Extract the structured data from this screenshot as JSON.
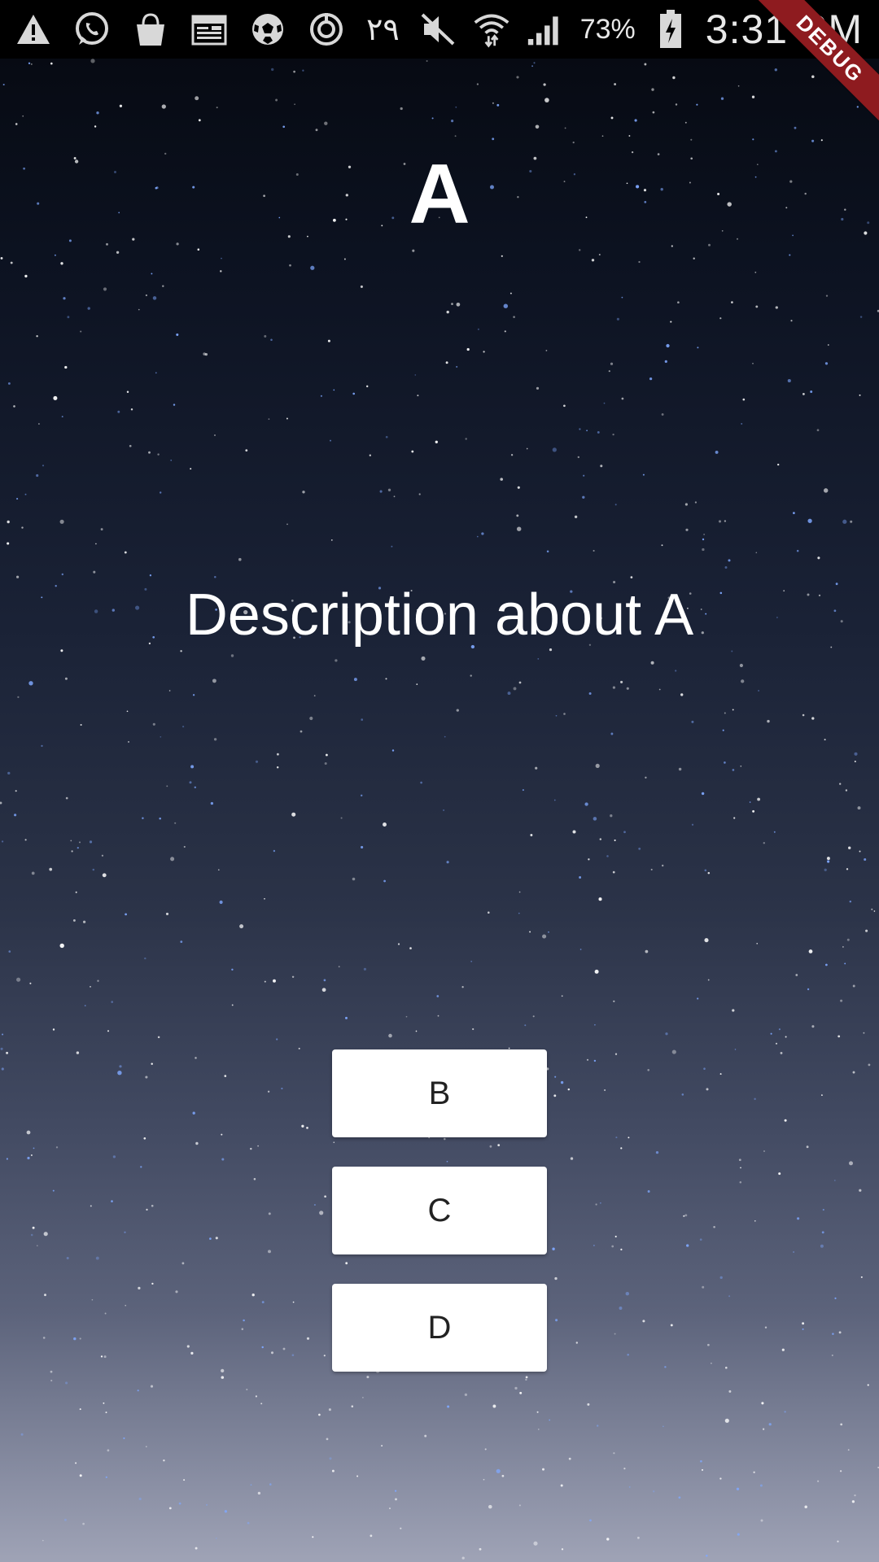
{
  "status_bar": {
    "date": "٢٩",
    "battery": "73%",
    "time": "3:31 PM",
    "icons": [
      "warning-icon",
      "whatsapp-icon",
      "shopping-bag-icon",
      "calendar-icon",
      "soccer-ball-icon",
      "power-ring-icon",
      "mute-icon",
      "wifi-icon",
      "signal-icon",
      "battery-charging-icon"
    ]
  },
  "debug_banner": "DEBUG",
  "title": "A",
  "description": "Description about A",
  "choices": {
    "b": "B",
    "c": "C",
    "d": "D"
  },
  "colors": {
    "button_bg": "#ffffff",
    "banner": "#8e1b1f",
    "text": "#ffffff"
  }
}
